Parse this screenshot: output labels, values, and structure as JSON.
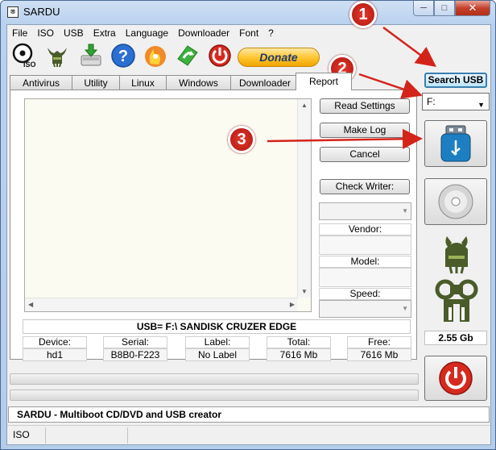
{
  "window": {
    "title": "SARDU",
    "app_icon_glyph": "⊠",
    "minimize_glyph": "─",
    "maximize_glyph": "□",
    "close_glyph": "✕"
  },
  "menu": [
    "File",
    "ISO",
    "USB",
    "Extra",
    "Language",
    "Downloader",
    "Font",
    "?"
  ],
  "toolbar": {
    "icons": [
      "iso-icon",
      "viking-helmet-icon",
      "download-disk-icon",
      "help-icon",
      "cd-flame-icon",
      "update-icon",
      "power-icon"
    ],
    "donate_label": "Donate"
  },
  "tabs": [
    "Antivirus",
    "Utility",
    "Linux",
    "Windows",
    "Downloader",
    "Report"
  ],
  "active_tab": "Report",
  "report": {
    "read_settings_label": "Read Settings",
    "make_log_label": "Make Log",
    "cancel_label": "Cancel",
    "check_writer_label": "Check Writer:",
    "vendor_label": "Vendor:",
    "model_label": "Model:",
    "speed_label": "Speed:"
  },
  "usb_info": "USB= F:\\ SANDISK CRUZER EDGE",
  "stats": [
    {
      "label": "Device:",
      "value": "hd1"
    },
    {
      "label": "Serial:",
      "value": "B8B0-F223"
    },
    {
      "label": "Label:",
      "value": "No Label"
    },
    {
      "label": "Total:",
      "value": "7616 Mb"
    },
    {
      "label": "Free:",
      "value": "7616 Mb"
    }
  ],
  "right": {
    "search_usb_label": "Search USB",
    "drive_value": "F:",
    "size_value": "2.55 Gb"
  },
  "status_text": "SARDU  - Multiboot CD/DVD and USB creator",
  "bottom_bar": {
    "mode": "ISO"
  },
  "annotations": {
    "one": "1",
    "two": "2",
    "three": "3"
  },
  "colors": {
    "accent": "#3c7fb1",
    "annotation": "#d4241a",
    "power": "#d62a1e",
    "usb_button": "#1d7fc1"
  }
}
